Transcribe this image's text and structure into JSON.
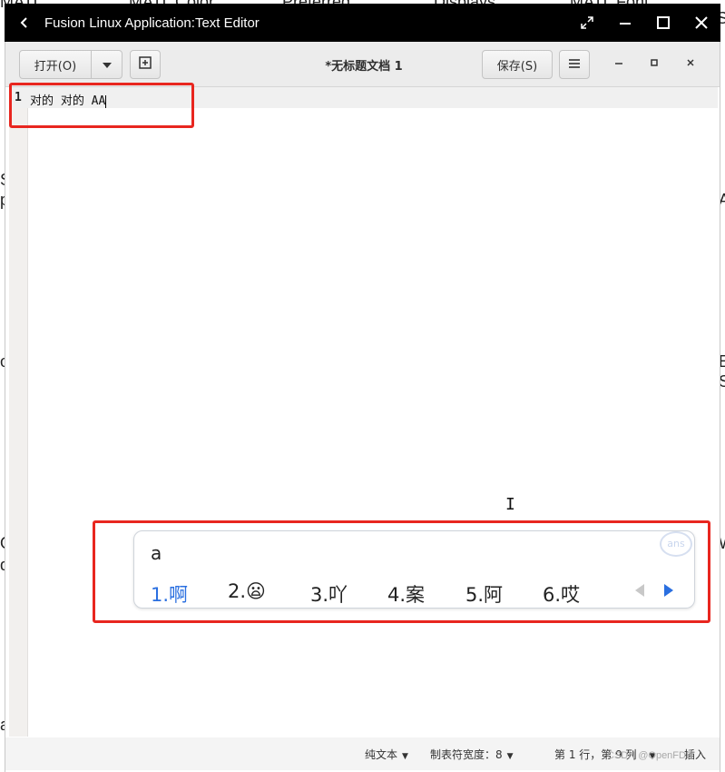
{
  "background": {
    "fragments": [
      "MATL",
      "MATL Color",
      "Preferred",
      "Displays",
      "MATL Font",
      "S",
      "S",
      "p",
      "A",
      "o",
      "E",
      "S",
      "O",
      "W",
      "d",
      "a"
    ]
  },
  "window": {
    "title": "Fusion Linux Application:Text Editor",
    "back_icon": "chevron-left-icon"
  },
  "header": {
    "open_label": "打开(O)",
    "doc_title": "*无标题文档 1",
    "save_label": "保存(S)"
  },
  "editor": {
    "line_number": "1",
    "line_text": "对的 对的 AA"
  },
  "statusbar": {
    "lang": "纯文本",
    "tab_width": "制表符宽度：8",
    "position": "第 1 行，第 9 列",
    "mode": "插入"
  },
  "ime": {
    "input": "a",
    "logo": "ans",
    "candidates": [
      "1.啊",
      "2.😦",
      "3.吖",
      "4.案",
      "5.阿",
      "6.哎"
    ]
  },
  "watermark": "CSDN @OpenFDE",
  "colors": {
    "highlight_box": "#e8261f",
    "ime_selected": "#2a6fe0"
  }
}
